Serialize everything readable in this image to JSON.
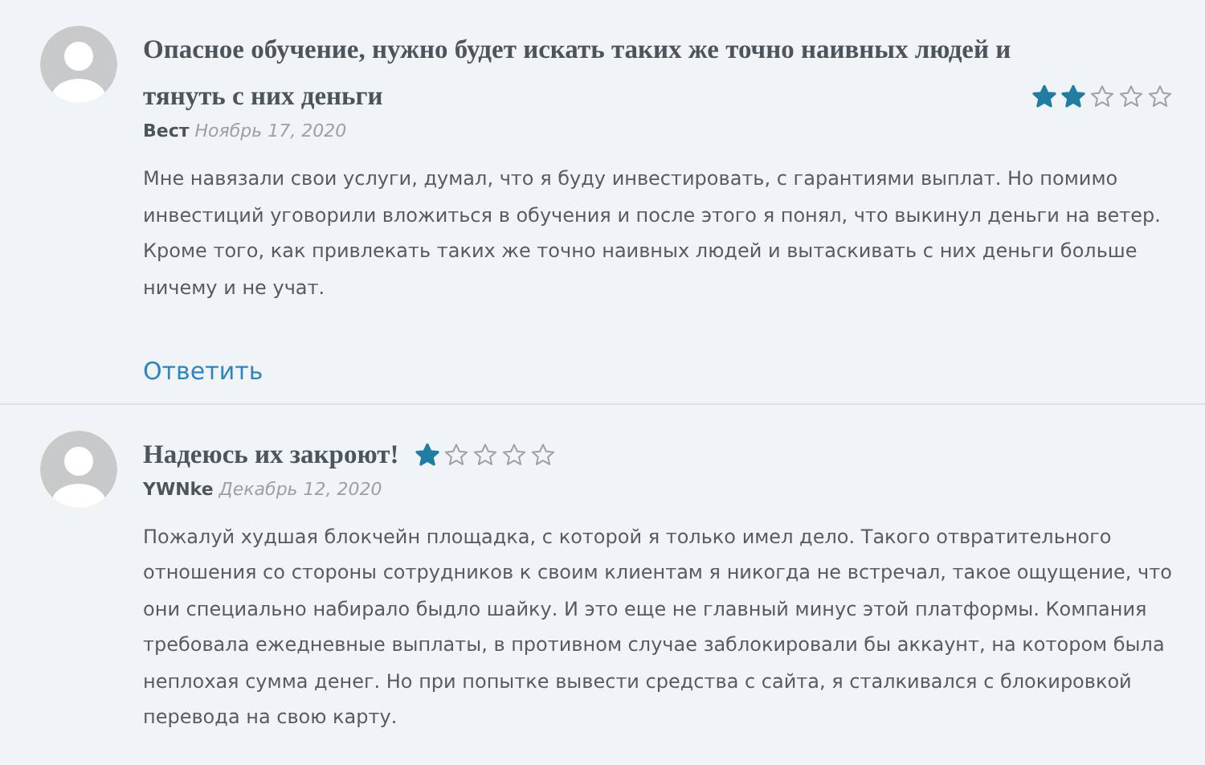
{
  "reviews": [
    {
      "title": "Опасное обучение, нужно будет искать таких же точно наивных людей и тянуть с них деньги",
      "stars": 2,
      "author": "Вест",
      "date": "Ноябрь 17, 2020",
      "text": "Мне навязали свои услуги, думал, что я буду инвестировать, с гарантиями выплат. Но помимо инвестиций уговорили вложиться в обучения и после этого я понял, что выкинул деньги на ветер. Кроме того, как привлекать таких же точно наивных людей и вытаскивать с них деньги больше ничему и не учат.",
      "reply": "Ответить"
    },
    {
      "title": "Надеюсь их закроют!",
      "stars": 1,
      "author": "YWNke",
      "date": "Декабрь 12, 2020",
      "text": "Пожалуй худшая блокчейн площадка, с которой я только имел дело. Такого отвратительного отношения со стороны сотрудников к своим клиентам я никогда не встречал, такое ощущение, что они специально набирало быдло шайку. И это еще не главный минус этой платформы. Компания требовала ежедневные выплаты, в противном случае заблокировали бы аккаунт, на котором была неплохая сумма денег. Но при попытке вывести средства с сайта, я сталкивался с блокировкой перевода на свою карту."
    }
  ]
}
